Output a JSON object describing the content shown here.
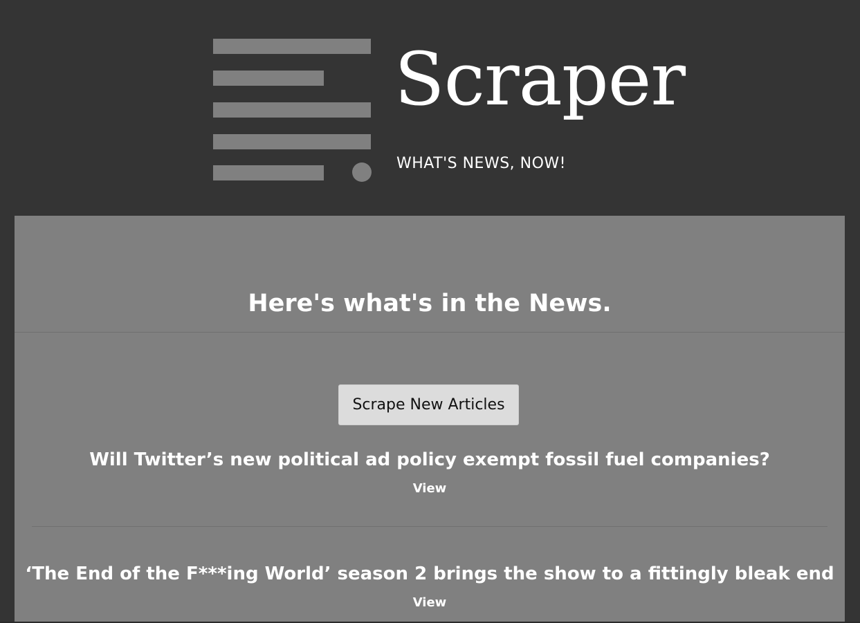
{
  "brand": {
    "name": "Scraper",
    "tagline": "WHAT'S NEWS, NOW!",
    "logo_icon": "news-lines-icon"
  },
  "main": {
    "heading": "Here's what's in the News.",
    "scrape_button_label": "Scrape New Articles",
    "articles": [
      {
        "title": "Will Twitter’s new political ad policy exempt fossil fuel companies?",
        "view_label": "View"
      },
      {
        "title": "‘The End of the F***ing World’ season 2 brings the show to a fittingly bleak end",
        "view_label": "View"
      }
    ]
  },
  "colors": {
    "background": "#343434",
    "panel": "#808080",
    "logo_gray": "#808080",
    "button": "#dcdcdc",
    "text": "#ffffff"
  }
}
